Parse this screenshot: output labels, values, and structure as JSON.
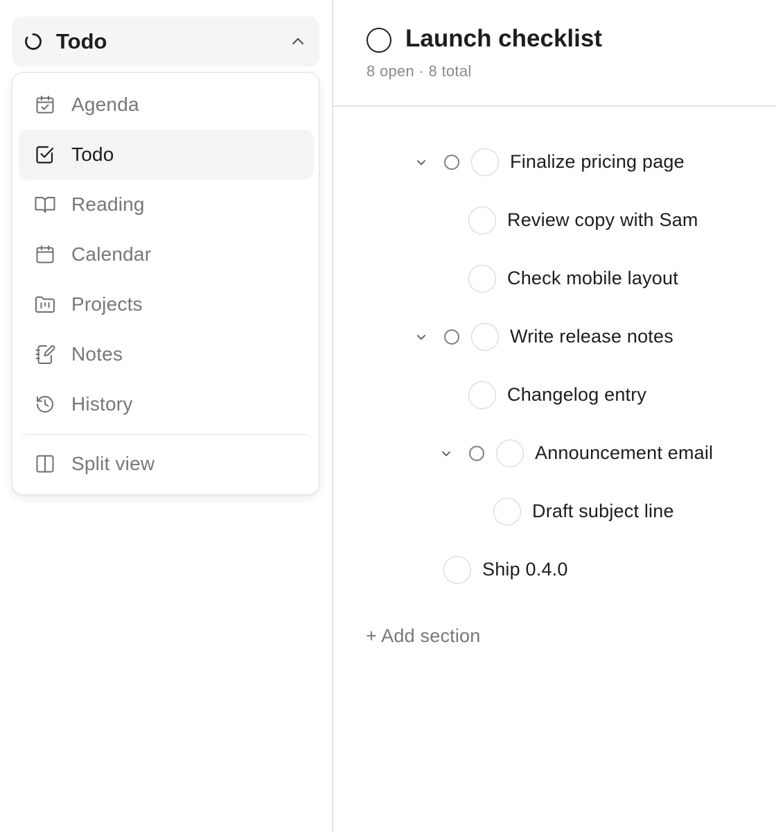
{
  "switcher": {
    "title": "Todo",
    "status_icon": "loading-ring-icon",
    "chevron_icon": "chevron-up-icon"
  },
  "menu": {
    "items": [
      {
        "label": "Agenda",
        "icon": "calendar-check-icon",
        "active": false
      },
      {
        "label": "Todo",
        "icon": "checkbox-icon",
        "active": true
      },
      {
        "label": "Reading",
        "icon": "book-open-icon",
        "active": false
      },
      {
        "label": "Calendar",
        "icon": "calendar-icon",
        "active": false
      },
      {
        "label": "Projects",
        "icon": "folder-kanban-icon",
        "active": false
      },
      {
        "label": "Notes",
        "icon": "notebook-pen-icon",
        "active": false
      },
      {
        "label": "History",
        "icon": "history-icon",
        "active": false
      }
    ],
    "footer": {
      "label": "Split view",
      "icon": "split-view-icon"
    }
  },
  "page": {
    "title": "Launch checklist",
    "subtitle": "8 open · 8 total"
  },
  "tasks": [
    {
      "label": "Finalize pricing page",
      "level": 0,
      "expandable": true
    },
    {
      "label": "Review copy with Sam",
      "level": 1,
      "expandable": false
    },
    {
      "label": "Check mobile layout",
      "level": 1,
      "expandable": false
    },
    {
      "label": "Write release notes",
      "level": 0,
      "expandable": true
    },
    {
      "label": "Changelog entry",
      "level": 1,
      "expandable": false
    },
    {
      "label": "Announcement email",
      "level": 1,
      "expandable": true
    },
    {
      "label": "Draft subject line",
      "level": 2,
      "expandable": false
    },
    {
      "label": "Ship 0.4.0",
      "level": 0,
      "expandable": false
    }
  ],
  "add_section": {
    "label": "+ Add section"
  },
  "colors": {
    "text": "#1d1d1f",
    "muted": "#77777b",
    "border": "#e4e4e4",
    "active_bg": "#f4f4f4"
  }
}
